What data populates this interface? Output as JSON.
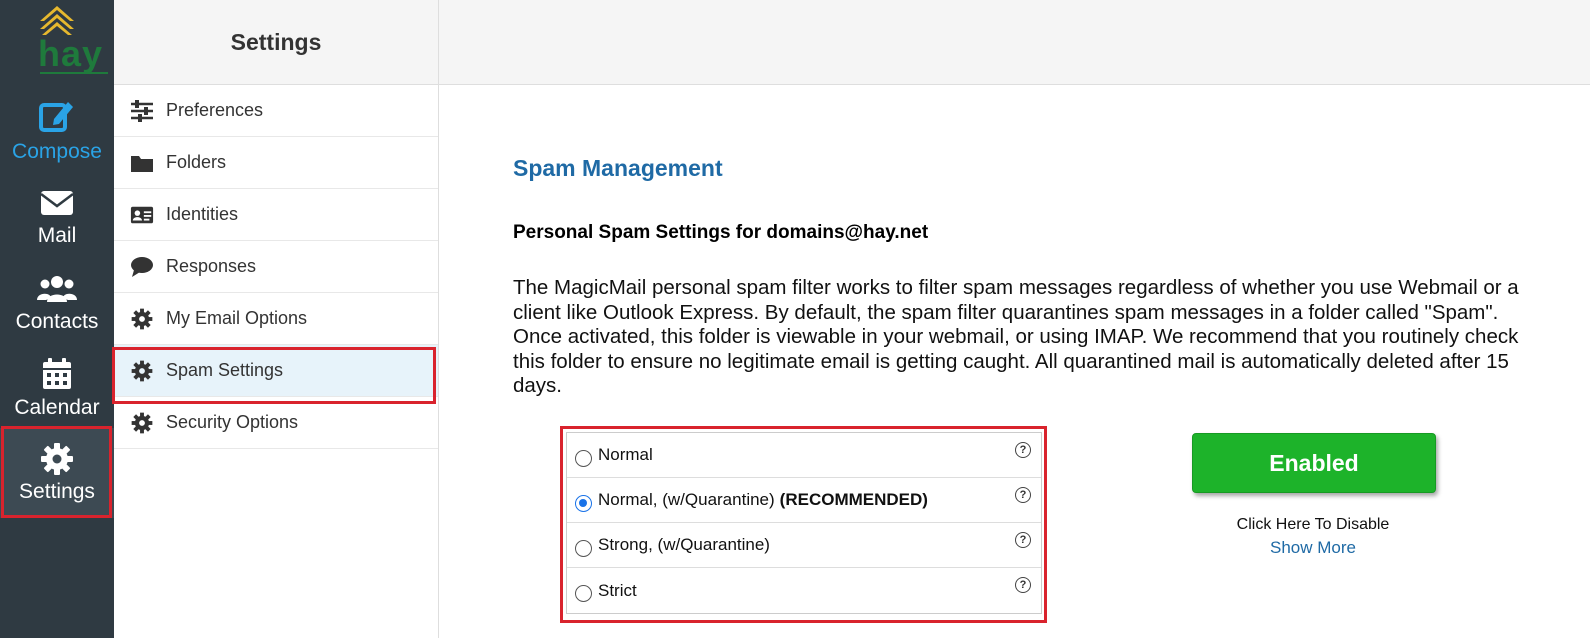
{
  "brand": {
    "logo_text": "hay",
    "accent": "#1f6aa5",
    "enabled_color": "#1db32a",
    "highlight_color": "#d9232d"
  },
  "rail": {
    "items": [
      {
        "label": "Compose",
        "icon": "compose-icon"
      },
      {
        "label": "Mail",
        "icon": "mail-icon"
      },
      {
        "label": "Contacts",
        "icon": "contacts-icon"
      },
      {
        "label": "Calendar",
        "icon": "calendar-icon"
      },
      {
        "label": "Settings",
        "icon": "gear-icon",
        "active": true
      }
    ]
  },
  "nav": {
    "title": "Settings",
    "items": [
      {
        "label": "Preferences",
        "icon": "sliders-icon"
      },
      {
        "label": "Folders",
        "icon": "folder-icon"
      },
      {
        "label": "Identities",
        "icon": "id-card-icon"
      },
      {
        "label": "Responses",
        "icon": "speech-bubble-icon"
      },
      {
        "label": "My Email Options",
        "icon": "gear-icon"
      },
      {
        "label": "Spam Settings",
        "icon": "gear-icon",
        "active": true
      },
      {
        "label": "Security Options",
        "icon": "gear-icon"
      }
    ]
  },
  "main": {
    "title": "Spam Management",
    "subtitle": "Personal Spam Settings for domains@hay.net",
    "description": "The MagicMail personal spam filter works to filter spam messages regardless of whether you use Webmail or a client like Outlook Express. By default, the spam filter quarantines spam messages in a folder called \"Spam\". Once activated, this folder is viewable in your webmail, or using IMAP. We recommend that you routinely check this folder to ensure no legitimate email is getting caught. All quarantined mail is automatically deleted after 15 days.",
    "options": [
      {
        "label": "Normal",
        "suffix": "",
        "checked": false
      },
      {
        "label": "Normal, (w/Quarantine)",
        "suffix": "(RECOMMENDED)",
        "checked": true
      },
      {
        "label": "Strong, (w/Quarantine)",
        "suffix": "",
        "checked": false
      },
      {
        "label": "Strict",
        "suffix": "",
        "checked": false
      }
    ],
    "help_symbol": "?",
    "status_button": "Enabled",
    "disable_text": "Click Here To Disable",
    "show_more": "Show More"
  }
}
